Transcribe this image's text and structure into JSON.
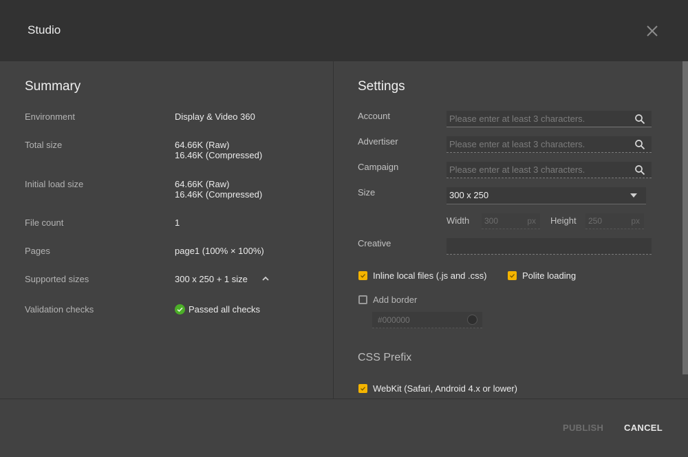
{
  "header": {
    "title": "Studio",
    "close_icon": "close-icon"
  },
  "summary": {
    "title": "Summary",
    "rows": [
      {
        "label": "Environment",
        "value": "Display & Video 360"
      },
      {
        "label": "Total size",
        "value_lines": [
          "64.66K (Raw)",
          "16.46K (Compressed)"
        ]
      },
      {
        "label": "Initial load size",
        "value_lines": [
          "64.66K (Raw)",
          "16.46K (Compressed)"
        ]
      },
      {
        "label": "File count",
        "value": "1"
      },
      {
        "label": "Pages",
        "value": "page1 (100% × 100%)"
      },
      {
        "label": "Supported sizes",
        "value": "300 x 250 + 1 size",
        "icon": "chevron-up-icon"
      },
      {
        "label": "Validation checks",
        "value": "Passed all checks",
        "icon": "check-circle-icon",
        "status_color": "#4caf28"
      }
    ]
  },
  "settings": {
    "title": "Settings",
    "account": {
      "label": "Account",
      "value": "",
      "placeholder": "Please enter at least 3 characters."
    },
    "advertiser": {
      "label": "Advertiser",
      "value": "",
      "placeholder": "Please enter at least 3 characters."
    },
    "campaign": {
      "label": "Campaign",
      "value": "",
      "placeholder": "Please enter at least 3 characters."
    },
    "size": {
      "label": "Size",
      "selected": "300 x 250",
      "width_label": "Width",
      "width_value": "300",
      "height_label": "Height",
      "height_value": "250",
      "unit": "px"
    },
    "creative": {
      "label": "Creative",
      "value": ""
    },
    "options": {
      "inline_local_files": {
        "label": "Inline local files (.js and .css)",
        "checked": true
      },
      "polite_loading": {
        "label": "Polite loading",
        "checked": true
      },
      "add_border": {
        "label": "Add border",
        "checked": false
      },
      "border_color": {
        "value": "#000000"
      }
    },
    "css_prefix": {
      "title": "CSS Prefix",
      "webkit": {
        "label": "WebKit (Safari, Android 4.x or lower)",
        "checked": true
      }
    },
    "accent_color": "#f4b400"
  },
  "footer": {
    "publish_label": "PUBLISH",
    "cancel_label": "CANCEL"
  }
}
